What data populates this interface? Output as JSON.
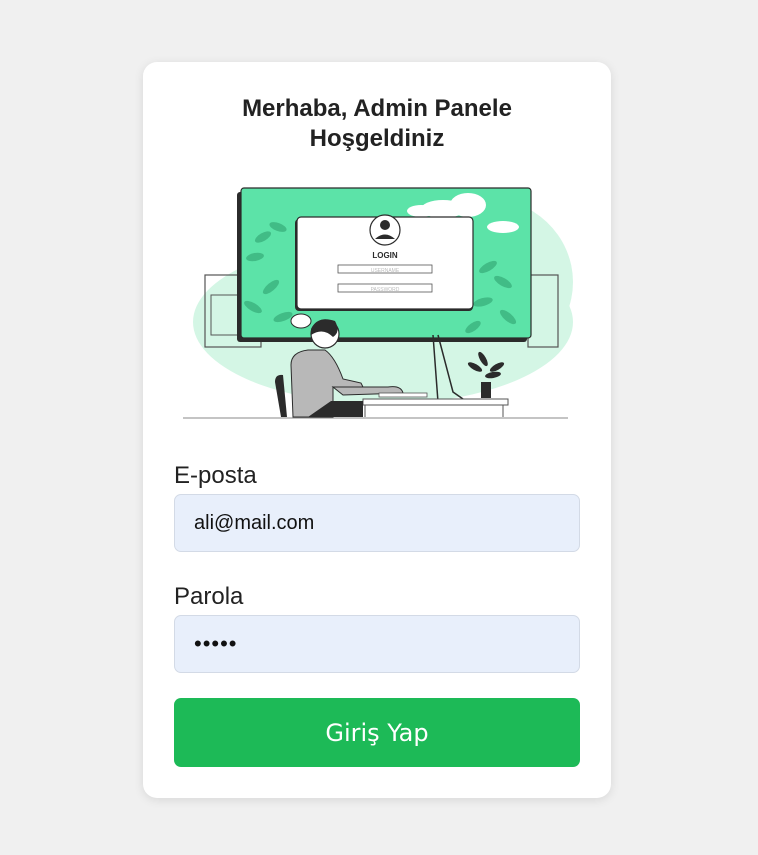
{
  "login": {
    "title": "Merhaba, Admin Panele Hoşgeldiniz",
    "illustration": {
      "screen_heading": "LOGIN",
      "screen_username_placeholder": "USERNAME",
      "screen_password_placeholder": "PASSWORD"
    },
    "email_label": "E-posta",
    "email_value": "ali@mail.com",
    "password_label": "Parola",
    "password_value": "•••••",
    "submit_label": "Giriş Yap"
  },
  "colors": {
    "page_bg": "#f0f0f0",
    "card_bg": "#ffffff",
    "input_bg": "#e8effb",
    "button_bg": "#1dba57",
    "illustration_green": "#5ce3a8"
  }
}
